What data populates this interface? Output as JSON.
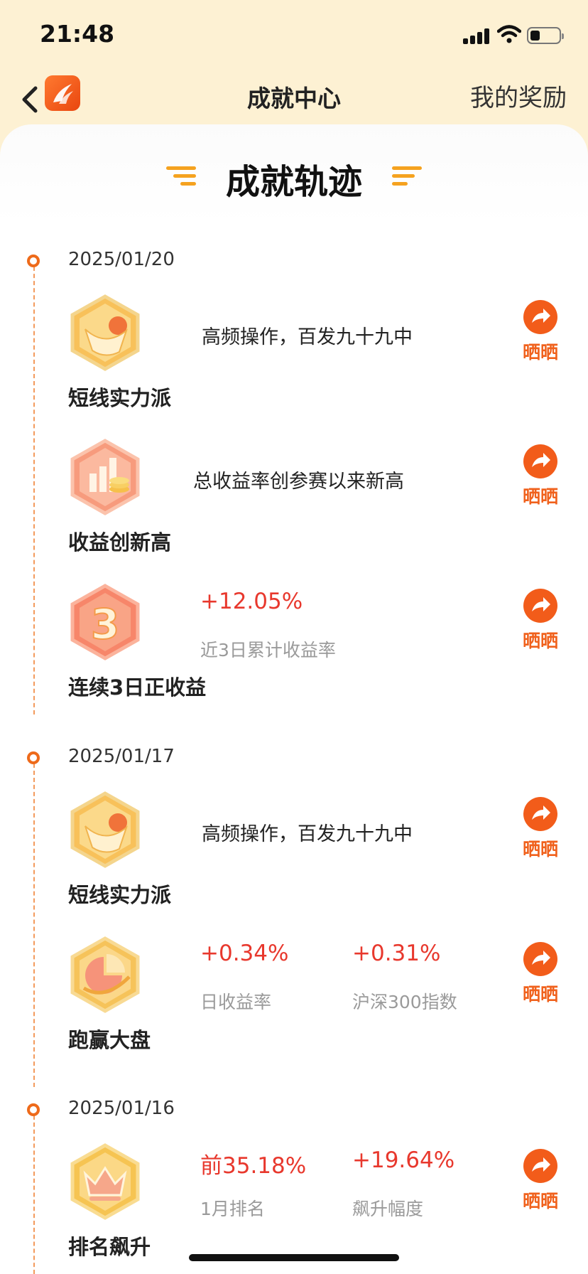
{
  "status_bar": {
    "time": "21:48"
  },
  "nav": {
    "title": "成就中心",
    "right_link": "我的奖励"
  },
  "section_title": "成就轨迹",
  "colors": {
    "accent": "#f0611c",
    "positive": "#e8382d",
    "header_bg": "#fdf1d3"
  },
  "timeline": [
    {
      "date": "2025/01/20",
      "items": [
        {
          "name": "短线实力派",
          "badge_icon": "short-term-badge-icon",
          "desc": "高频操作，百发九十九中",
          "share": "晒晒"
        },
        {
          "name": "收益创新高",
          "badge_icon": "record-high-badge-icon",
          "desc": "总收益率创参赛以来新高",
          "share": "晒晒"
        },
        {
          "name": "连续3日正收益",
          "badge_icon": "three-day-badge-icon",
          "stats": [
            {
              "value": "+12.05%",
              "label": "近3日累计收益率"
            }
          ],
          "share": "晒晒"
        }
      ]
    },
    {
      "date": "2025/01/17",
      "items": [
        {
          "name": "短线实力派",
          "badge_icon": "short-term-badge-icon",
          "desc": "高频操作，百发九十九中",
          "share": "晒晒"
        },
        {
          "name": "跑赢大盘",
          "badge_icon": "beat-market-badge-icon",
          "stats": [
            {
              "value": "+0.34%",
              "label": "日收益率"
            },
            {
              "value": "+0.31%",
              "label": "沪深300指数"
            }
          ],
          "share": "晒晒"
        }
      ]
    },
    {
      "date": "2025/01/16",
      "items": [
        {
          "name": "排名飙升",
          "badge_icon": "rank-up-badge-icon",
          "stats": [
            {
              "value": "前35.18%",
              "label": "1月排名"
            },
            {
              "value": "+19.64%",
              "label": "飙升幅度"
            }
          ],
          "share": "晒晒"
        }
      ]
    }
  ]
}
